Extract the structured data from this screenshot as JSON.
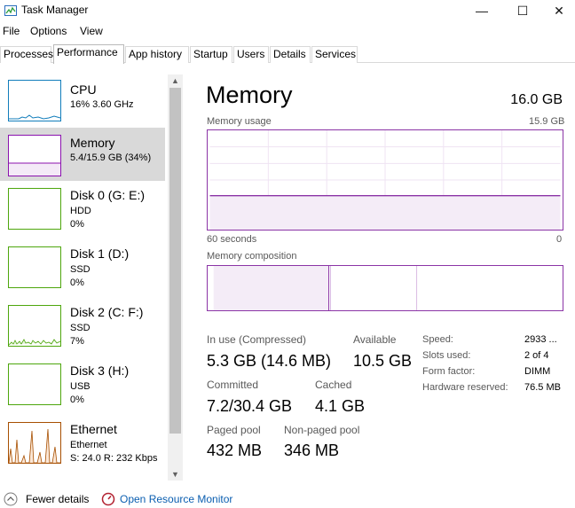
{
  "window": {
    "title": "Task Manager",
    "minimize_glyph": "—",
    "maximize_glyph": "☐",
    "close_glyph": "✕"
  },
  "menu": [
    "File",
    "Options",
    "View"
  ],
  "tabs": [
    "Processes",
    "Performance",
    "App history",
    "Startup",
    "Users",
    "Details",
    "Services"
  ],
  "active_tab": "Performance",
  "sidebar": {
    "items": [
      {
        "title": "CPU",
        "line1": "16%  3.60 GHz",
        "line2": "",
        "thumb_color": "#117dbb"
      },
      {
        "title": "Memory",
        "line1": "5.4/15.9 GB (34%)",
        "line2": "",
        "thumb_color": "#8b12ae",
        "selected": true
      },
      {
        "title": "Disk 0 (G: E:)",
        "line1": "HDD",
        "line2": "0%",
        "thumb_color": "#4da60c"
      },
      {
        "title": "Disk 1 (D:)",
        "line1": "SSD",
        "line2": "0%",
        "thumb_color": "#4da60c"
      },
      {
        "title": "Disk 2 (C: F:)",
        "line1": "SSD",
        "line2": "7%",
        "thumb_color": "#4da60c"
      },
      {
        "title": "Disk 3 (H:)",
        "line1": "USB",
        "line2": "0%",
        "thumb_color": "#4da60c"
      },
      {
        "title": "Ethernet",
        "line1": "Ethernet",
        "line2": "S: 24.0  R: 232 Kbps",
        "thumb_color": "#a74f01"
      }
    ]
  },
  "memory": {
    "title": "Memory",
    "total": "16.0 GB",
    "usage_label": "Memory usage",
    "usage_max": "15.9 GB",
    "x_left": "60 seconds",
    "x_right": "0",
    "usage_fraction": 0.34,
    "composition_label": "Memory composition",
    "stats": {
      "in_use_label": "In use (Compressed)",
      "in_use_value": "5.3 GB (14.6 MB)",
      "available_label": "Available",
      "available_value": "10.5 GB",
      "committed_label": "Committed",
      "committed_value": "7.2/30.4 GB",
      "cached_label": "Cached",
      "cached_value": "4.1 GB",
      "paged_label": "Paged pool",
      "paged_value": "432 MB",
      "nonpaged_label": "Non-paged pool",
      "nonpaged_value": "346 MB"
    },
    "details": [
      {
        "label": "Speed:",
        "value": "2933 ..."
      },
      {
        "label": "Slots used:",
        "value": "2 of 4"
      },
      {
        "label": "Form factor:",
        "value": "DIMM"
      },
      {
        "label": "Hardware reserved:",
        "value": "76.5 MB"
      }
    ],
    "accent": "#8b34a6"
  },
  "footer": {
    "fewer_details": "Fewer details",
    "resource_monitor": "Open Resource Monitor"
  }
}
